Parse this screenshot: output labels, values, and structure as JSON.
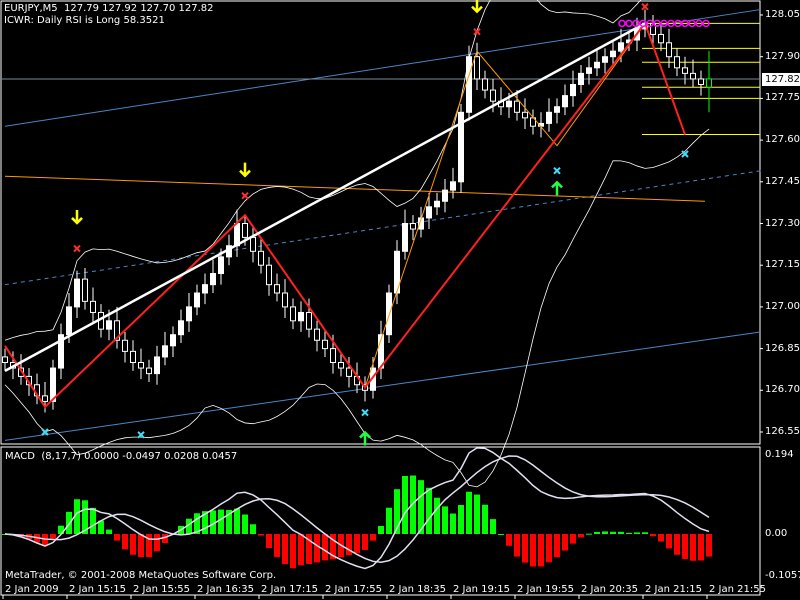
{
  "header": {
    "symbol_line": "EURJPY,M5  127.79 127.92 127.70 127.82",
    "indicator_line": "ICWR: Daily RSI is Long 58.3521"
  },
  "macd": {
    "label": "MACD  (8,17,7) 0.0000 -0.0497 0.0208 0.0457",
    "axis": [
      "0.194",
      "0.00",
      "-0.1057"
    ],
    "ylim": [
      -0.1057,
      0.194
    ],
    "fast": 8,
    "slow": 17,
    "signal": 7
  },
  "copyright": "MetaTrader, © 2001-2008 MetaQuotes Software Corp.",
  "current_price": "127.82",
  "colors": {
    "bg": "#000000",
    "axis": "#ffffff",
    "zigzag": "#ff2020",
    "orange": "#ff9900",
    "channel": "#4a86c8",
    "level": "#ffff00",
    "hist_up": "#00ff00",
    "hist_down": "#ff0000",
    "macd_line": "#e0e0f0"
  },
  "chart_data": {
    "type": "candlestick",
    "title": "EURJPY,M5",
    "ylim": [
      126.5,
      128.09
    ],
    "y_ticks": [
      "128.05",
      "127.90",
      "127.75",
      "127.60",
      "127.45",
      "127.30",
      "127.15",
      "127.00",
      "126.85",
      "126.70",
      "126.55"
    ],
    "x_ticks": [
      "2 Jan 2009",
      "2 Jan 15:15",
      "2 Jan 15:55",
      "2 Jan 16:35",
      "2 Jan 17:15",
      "2 Jan 17:55",
      "2 Jan 18:35",
      "2 Jan 19:15",
      "2 Jan 19:55",
      "2 Jan 20:35",
      "2 Jan 21:15",
      "2 Jan 21:55"
    ],
    "closes": [
      126.8,
      126.78,
      126.75,
      126.72,
      126.68,
      126.66,
      126.78,
      126.9,
      127.0,
      127.1,
      127.02,
      126.98,
      126.92,
      126.95,
      126.88,
      126.84,
      126.8,
      126.78,
      126.76,
      126.82,
      126.86,
      126.9,
      126.95,
      127.0,
      127.05,
      127.08,
      127.12,
      127.18,
      127.22,
      127.3,
      127.25,
      127.2,
      127.15,
      127.08,
      127.05,
      127.0,
      126.95,
      126.98,
      126.92,
      126.88,
      126.85,
      126.8,
      126.78,
      126.75,
      126.72,
      126.7,
      126.78,
      126.9,
      127.05,
      127.2,
      127.3,
      127.28,
      127.32,
      127.36,
      127.38,
      127.42,
      127.45,
      127.7,
      127.9,
      127.82,
      127.78,
      127.74,
      127.72,
      127.74,
      127.7,
      127.68,
      127.65,
      127.66,
      127.7,
      127.72,
      127.76,
      127.8,
      127.84,
      127.86,
      127.88,
      127.9,
      127.92,
      127.95,
      127.96,
      128.0,
      128.02,
      127.98,
      127.95,
      127.9,
      127.86,
      127.84,
      127.82,
      127.8,
      127.82
    ],
    "last_bar": {
      "open": 127.79,
      "high": 127.92,
      "low": 127.7,
      "close": 127.82
    },
    "zigzag": [
      [
        0,
        126.86
      ],
      [
        5,
        126.64
      ],
      [
        30,
        127.33
      ],
      [
        45,
        126.71
      ],
      [
        80,
        128.02
      ],
      [
        85,
        127.62
      ]
    ],
    "zigzag_minor": [
      [
        45,
        126.71
      ],
      [
        59,
        127.92
      ],
      [
        69,
        127.58
      ],
      [
        80,
        128.02
      ]
    ],
    "regression_line": [
      [
        0,
        126.77
      ],
      [
        80,
        128.02
      ]
    ],
    "channel_upper": [
      [
        0,
        127.65
      ],
      [
        94.5,
        128.07
      ]
    ],
    "channel_lower": [
      [
        0,
        126.52
      ],
      [
        94.5,
        126.91
      ]
    ],
    "channel_mid": [
      [
        0,
        127.08
      ],
      [
        94.5,
        127.49
      ]
    ],
    "orange_line": [
      [
        0,
        127.47
      ],
      [
        87.5,
        127.38
      ]
    ],
    "levels": [
      128.02,
      127.93,
      127.88,
      127.79,
      127.75,
      127.62
    ],
    "signals_down_arrow": [
      [
        9,
        127.32
      ],
      [
        30,
        127.49
      ],
      [
        59,
        128.08
      ]
    ],
    "signals_red_x": [
      [
        9,
        127.21
      ],
      [
        30,
        127.4
      ],
      [
        59,
        127.99
      ],
      [
        80,
        128.08
      ]
    ],
    "signals_cyan_x": [
      [
        5,
        126.55
      ],
      [
        17,
        126.54
      ],
      [
        45,
        126.62
      ],
      [
        69,
        127.49
      ],
      [
        85,
        127.55
      ]
    ],
    "signals_up_arrow": [
      [
        45,
        126.53
      ],
      [
        69,
        127.43
      ]
    ]
  }
}
